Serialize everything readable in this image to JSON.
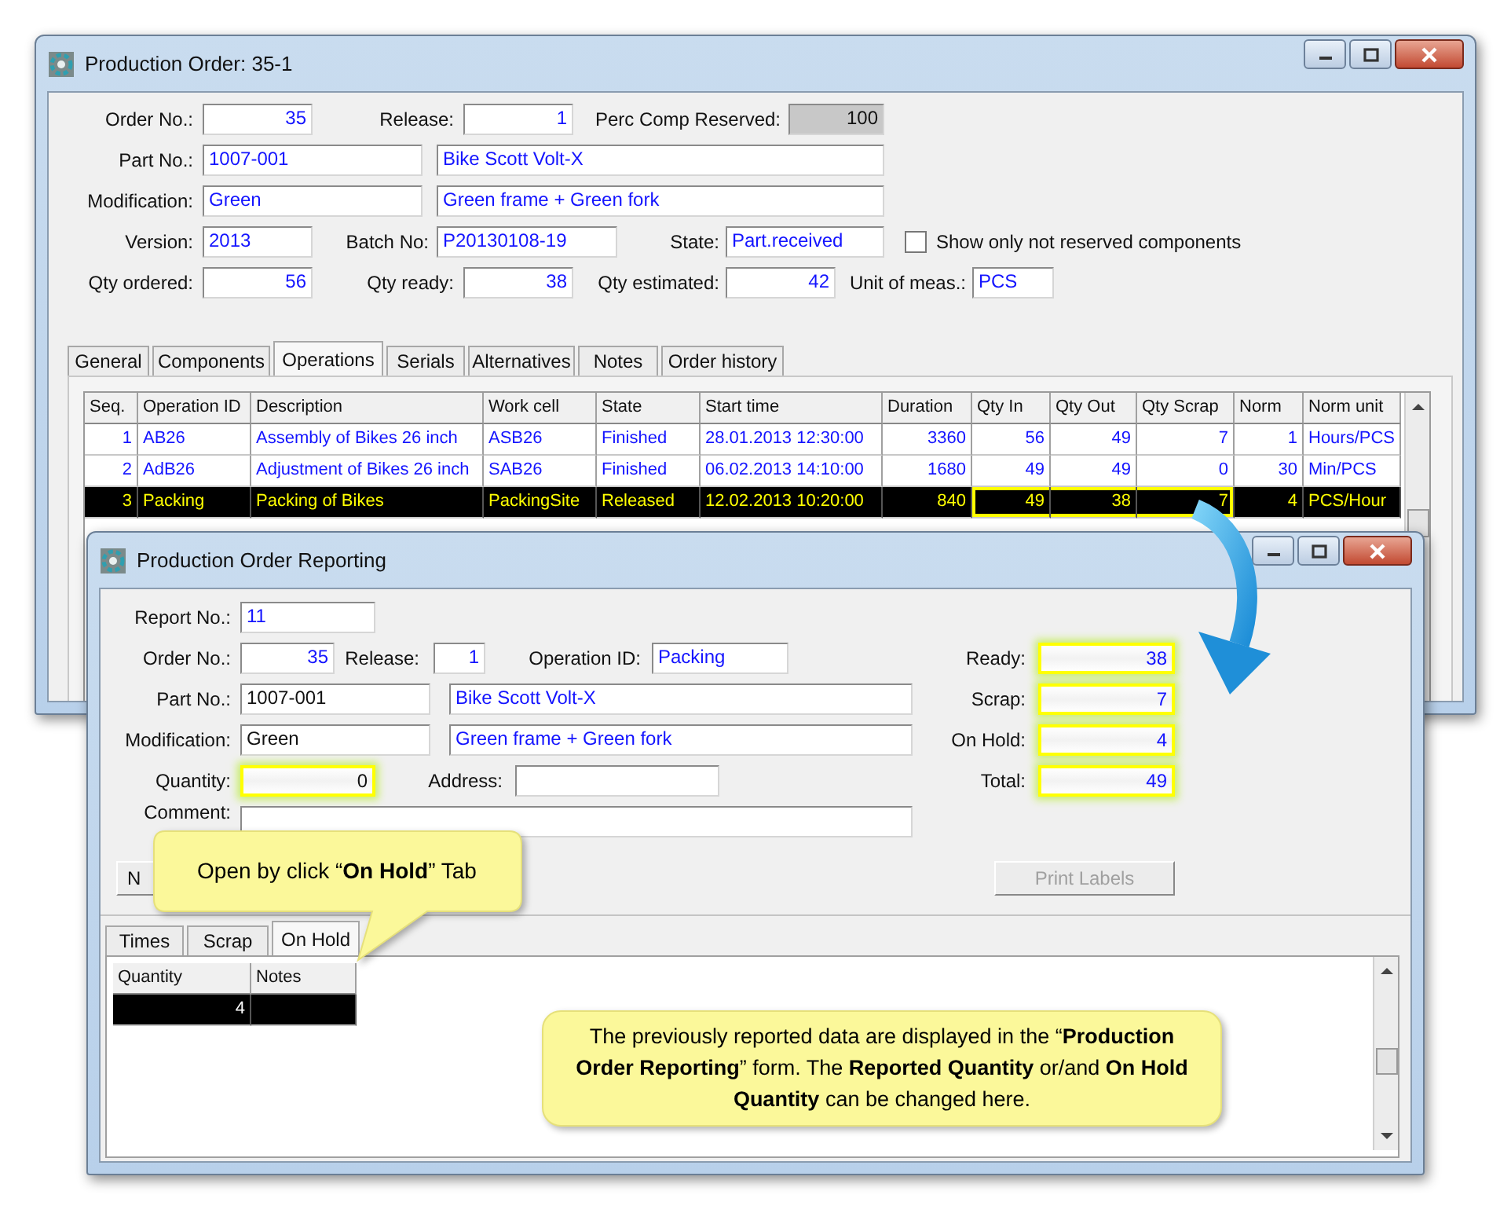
{
  "main_window": {
    "title": "Production Order: 35-1",
    "form": [
      [
        {
          "kind": "label",
          "text": "Order No.:"
        },
        {
          "kind": "field",
          "value": "35"
        },
        {
          "kind": "label",
          "text": "Release:"
        },
        {
          "kind": "field",
          "value": "1"
        },
        {
          "kind": "label",
          "text": "Perc Comp Reserved:"
        },
        {
          "kind": "grey-field",
          "value": "100"
        }
      ],
      [
        {
          "kind": "label",
          "text": "Part No.:"
        },
        {
          "kind": "field",
          "value": "1007-001"
        },
        {
          "kind": "field",
          "value": "Bike Scott Volt-X"
        }
      ],
      [
        {
          "kind": "label",
          "text": "Modification:"
        },
        {
          "kind": "field",
          "value": "Green"
        },
        {
          "kind": "field",
          "value": "Green frame + Green fork"
        }
      ],
      [
        {
          "kind": "label",
          "text": "Version:"
        },
        {
          "kind": "field",
          "value": "2013"
        },
        {
          "kind": "label",
          "text": "Batch No:"
        },
        {
          "kind": "field",
          "value": "P20130108-19"
        },
        {
          "kind": "label",
          "text": "State:"
        },
        {
          "kind": "field",
          "value": "Part.received"
        },
        {
          "kind": "checkbox",
          "label": "Show only not reserved components",
          "checked": false
        }
      ],
      [
        {
          "kind": "label",
          "text": "Qty ordered:"
        },
        {
          "kind": "field",
          "value": "56"
        },
        {
          "kind": "label",
          "text": "Qty ready:"
        },
        {
          "kind": "field",
          "value": "38"
        },
        {
          "kind": "label",
          "text": "Qty estimated:"
        },
        {
          "kind": "field",
          "value": "42"
        },
        {
          "kind": "label",
          "text": "Unit of meas.:"
        },
        {
          "kind": "field",
          "value": "PCS"
        }
      ]
    ],
    "tabs": [
      {
        "label": "General",
        "selected": false
      },
      {
        "label": "Components",
        "selected": false
      },
      {
        "label": "Operations",
        "selected": true
      },
      {
        "label": "Serials",
        "selected": false
      },
      {
        "label": "Alternatives",
        "selected": false
      },
      {
        "label": "Notes",
        "selected": false
      },
      {
        "label": "Order history",
        "selected": false
      }
    ],
    "table": {
      "columns": [
        {
          "label": "Seq.",
          "highlighted": false
        },
        {
          "label": "Operation ID",
          "highlighted": false
        },
        {
          "label": "Description",
          "highlighted": false
        },
        {
          "label": "Work cell",
          "highlighted": false
        },
        {
          "label": "State",
          "highlighted": false
        },
        {
          "label": "Start time",
          "highlighted": false
        },
        {
          "label": "Duration",
          "highlighted": false
        },
        {
          "label": "Qty In",
          "highlighted": true
        },
        {
          "label": "Qty Out",
          "highlighted": true
        },
        {
          "label": "Qty Scrap",
          "highlighted": true
        },
        {
          "label": "Norm",
          "highlighted": false
        },
        {
          "label": "Norm unit",
          "highlighted": false
        }
      ],
      "rows": [
        {
          "selected": false,
          "cells": [
            "1",
            "AB26",
            "Assembly of Bikes 26 inch",
            "ASB26",
            "Finished",
            "28.01.2013 12:30:00",
            "3360",
            "56",
            "49",
            "7",
            "1",
            "Hours/PCS"
          ]
        },
        {
          "selected": false,
          "cells": [
            "2",
            "AdB26",
            "Adjustment of Bikes 26 inch",
            "SAB26",
            "Finished",
            "06.02.2013 14:10:00",
            "1680",
            "49",
            "49",
            "0",
            "30",
            "Min/PCS"
          ]
        },
        {
          "selected": true,
          "cells": [
            "3",
            "Packing",
            "Packing of Bikes",
            "PackingSite",
            "Released",
            "12.02.2013 10:20:00",
            "840",
            "49",
            "38",
            "7",
            "4",
            "PCS/Hour"
          ]
        }
      ]
    }
  },
  "report_window": {
    "title": "Production Order Reporting",
    "form": [
      [
        {
          "kind": "label",
          "text": "Report No.:"
        },
        {
          "kind": "field",
          "value": "11"
        }
      ],
      [
        {
          "kind": "label",
          "text": "Order No.:"
        },
        {
          "kind": "field",
          "value": "35"
        },
        {
          "kind": "label",
          "text": "Release:"
        },
        {
          "kind": "field",
          "value": "1"
        },
        {
          "kind": "label",
          "text": "Operation ID:"
        },
        {
          "kind": "field",
          "value": "Packing"
        },
        {
          "kind": "label",
          "text": "Ready:"
        },
        {
          "kind": "highlighted-field",
          "value": "38"
        }
      ],
      [
        {
          "kind": "label",
          "text": "Part No.:"
        },
        {
          "kind": "plain-field",
          "value": "1007-001"
        },
        {
          "kind": "field",
          "value": "Bike Scott Volt-X"
        },
        {
          "kind": "label",
          "text": "Scrap:"
        },
        {
          "kind": "highlighted-field",
          "value": "7"
        }
      ],
      [
        {
          "kind": "label",
          "text": "Modification:"
        },
        {
          "kind": "plain-field",
          "value": "Green"
        },
        {
          "kind": "field",
          "value": "Green frame + Green fork"
        },
        {
          "kind": "label",
          "text": "On Hold:"
        },
        {
          "kind": "highlighted-field",
          "value": "4"
        }
      ],
      [
        {
          "kind": "label",
          "text": "Quantity:"
        },
        {
          "kind": "highlighted-plain-field",
          "value": "0"
        },
        {
          "kind": "label",
          "text": "Address:"
        },
        {
          "kind": "field"
        },
        {
          "kind": "label",
          "text": "Total:"
        },
        {
          "kind": "highlighted-field",
          "value": "49"
        }
      ],
      [
        {
          "kind": "label",
          "text": "Comment:"
        },
        {
          "kind": "field"
        }
      ]
    ],
    "side_button": {
      "label": "N"
    },
    "print_button": {
      "label": "Print Labels",
      "disabled": true
    },
    "tabs": [
      {
        "label": "Times",
        "selected": false
      },
      {
        "label": "Scrap",
        "selected": false
      },
      {
        "label": "On Hold",
        "selected": true
      }
    ],
    "grid": {
      "columns": [
        "Quantity",
        "Notes"
      ],
      "rows": [
        {
          "selected": true,
          "cells": [
            "4"
          ]
        }
      ]
    }
  },
  "callouts": [
    {
      "kind": "pointer",
      "text": "Open by click “**On Hold**” Tab"
    },
    {
      "kind": "note",
      "text": "The previously reported data are displayed in the “**Production  Order Reporting**” form. The **Reported Quantity** or/and **On Hold Quantity** can be changed here."
    }
  ]
}
